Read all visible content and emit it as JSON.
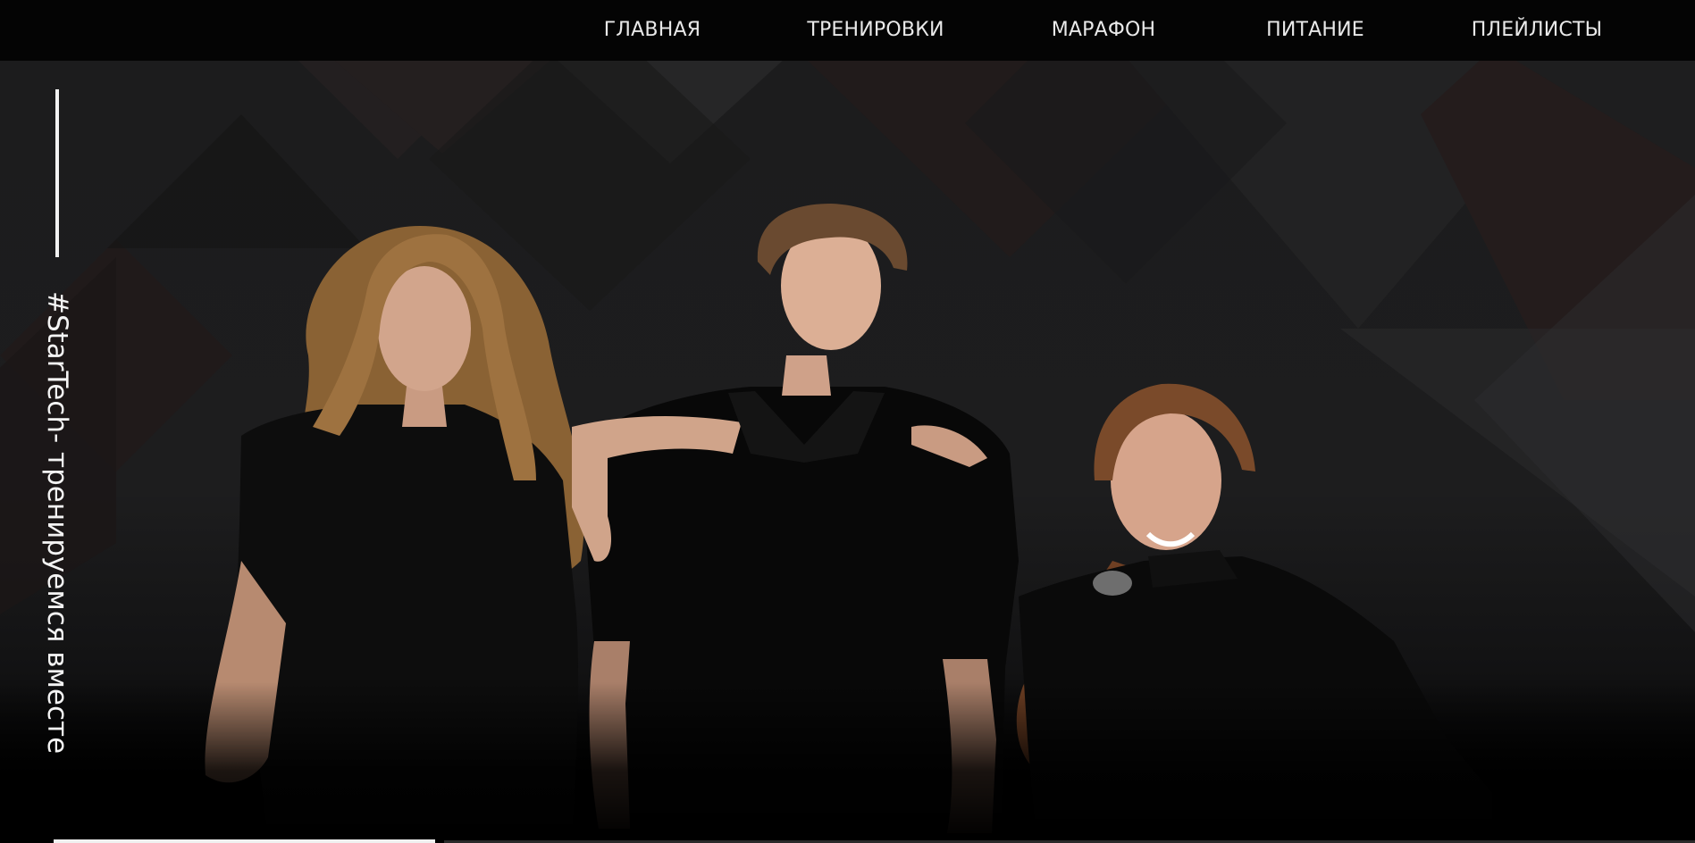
{
  "nav": {
    "items": [
      {
        "label": "ГЛАВНАЯ"
      },
      {
        "label": "ТРЕНИРОВКИ"
      },
      {
        "label": "МАРАФОН"
      },
      {
        "label": "ПИТАНИЕ"
      },
      {
        "label": "ПЛЕЙЛИСТЫ"
      }
    ]
  },
  "hero": {
    "tagline": "#StarTech- тренируемся вместе"
  },
  "colors": {
    "background": "#000000",
    "nav_text": "#e9e9e9",
    "tagline_text": "#f4f4f4"
  }
}
